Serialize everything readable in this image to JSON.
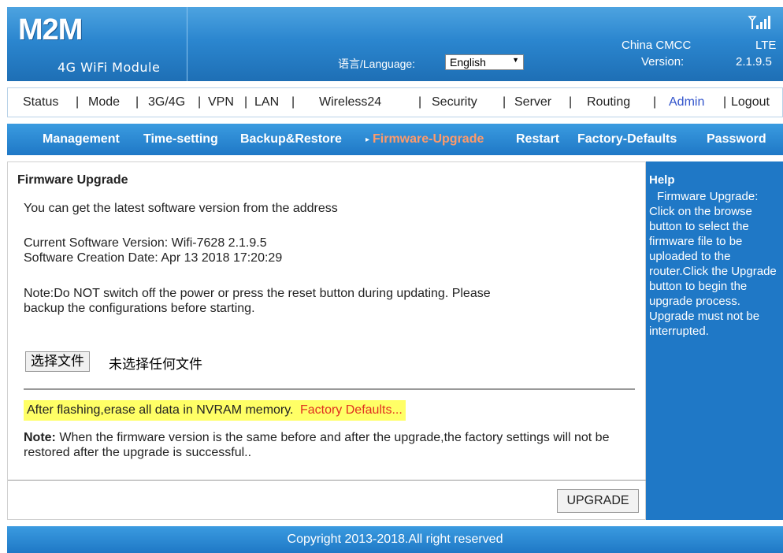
{
  "header": {
    "logo": "M2M",
    "subtitle": "4G WiFi Module",
    "language_label": "语言/Language:",
    "language_value": "English",
    "signal_icon": "signal-bars-icon",
    "carrier": "China CMCC",
    "network": "LTE",
    "version_label": "Version:",
    "version_value": "2.1.9.5"
  },
  "mainnav": {
    "items": [
      "Status",
      "Mode",
      "3G/4G",
      "VPN",
      "LAN",
      "Wireless24",
      "Security",
      "Server",
      "Routing",
      "Admin",
      "Logout"
    ],
    "separator": "|"
  },
  "subnav": {
    "items": [
      "Management",
      "Time-setting",
      "Backup&Restore",
      "Firmware-Upgrade",
      "Restart",
      "Factory-Defaults",
      "Password"
    ],
    "current_marker": "▸"
  },
  "content": {
    "title": "Firmware Upgrade",
    "intro": "You can get the latest software version from the address",
    "current_version": "Current Software Version: Wifi-7628  2.1.9.5",
    "creation_date": "Software Creation Date:  Apr 13 2018 17:20:29",
    "note_line1": "Note:Do NOT switch off the power or press the reset button during updating. Please",
    "note_line2": "backup the configurations before starting.",
    "file_button": "选择文件",
    "file_status": "未选择任何文件",
    "flash_text": "After flashing,erase all data in NVRAM memory.",
    "flash_link": "Factory Defaults...",
    "note2_label": "Note:",
    "note2_text": " When the firmware version is the same before and after the upgrade,the factory settings will not be restored after the upgrade is successful..",
    "upgrade_button": "UPGRADE"
  },
  "help": {
    "title": "Help",
    "text": "Firmware Upgrade: Click on the browse button to select the firmware file to be uploaded to the router.Click the Upgrade button to begin the upgrade process. Upgrade must not be interrupted."
  },
  "footer": {
    "copyright": "Copyright 2013-2018.All right reserved"
  },
  "colors": {
    "header_blue": "#2b86cf",
    "active_subnav": "#ff9a6a",
    "active_mainnav": "#3355cc",
    "highlight_yellow": "#ffff66",
    "link_red": "#e03020"
  }
}
